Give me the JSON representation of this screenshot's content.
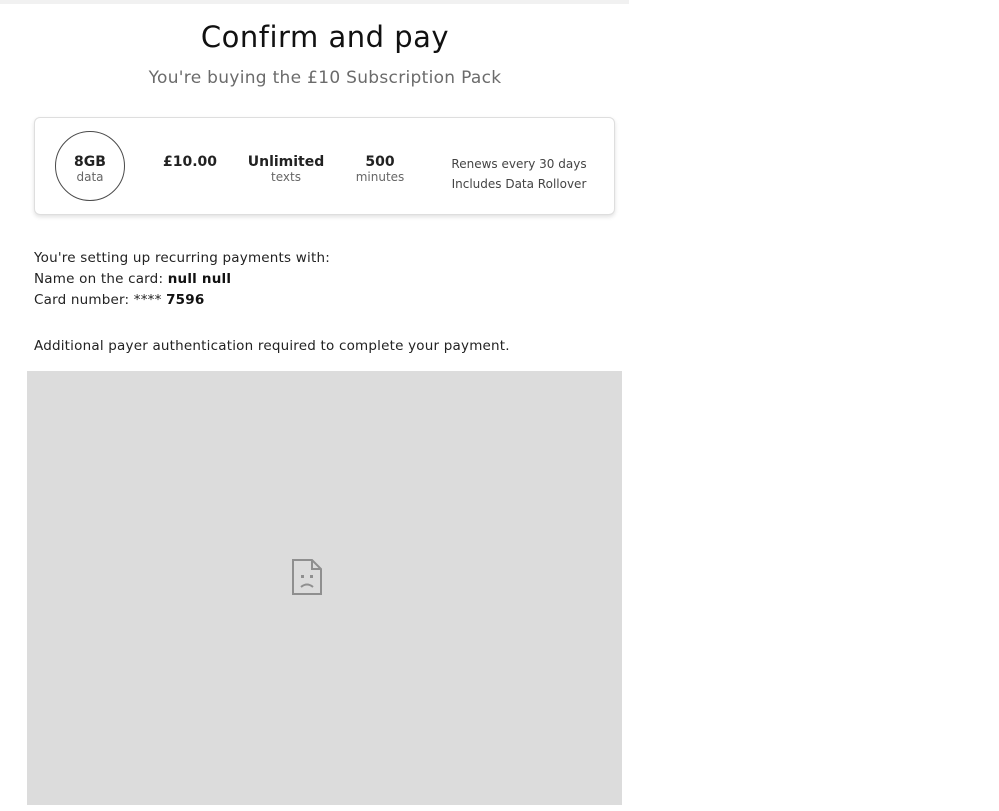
{
  "page": {
    "title": "Confirm and pay",
    "subtitle": "You're buying the £10 Subscription Pack"
  },
  "pack": {
    "data_value": "8GB",
    "data_unit": "data",
    "price": "£10.00",
    "texts_value": "Unlimited",
    "texts_unit": "texts",
    "minutes_value": "500",
    "minutes_unit": "minutes",
    "renewal": "Renews every 30 days",
    "rollover": "Includes Data Rollover"
  },
  "payment": {
    "intro": "You're setting up recurring payments with:",
    "name_label": "Name on the card: ",
    "name_value": "null null",
    "card_label": "Card number: **** ",
    "card_value": "7596"
  },
  "auth": {
    "note": "Additional payer authentication required to complete your payment.",
    "frame_icon": "sad-document-icon",
    "frame_color": "#dcdcdc"
  }
}
